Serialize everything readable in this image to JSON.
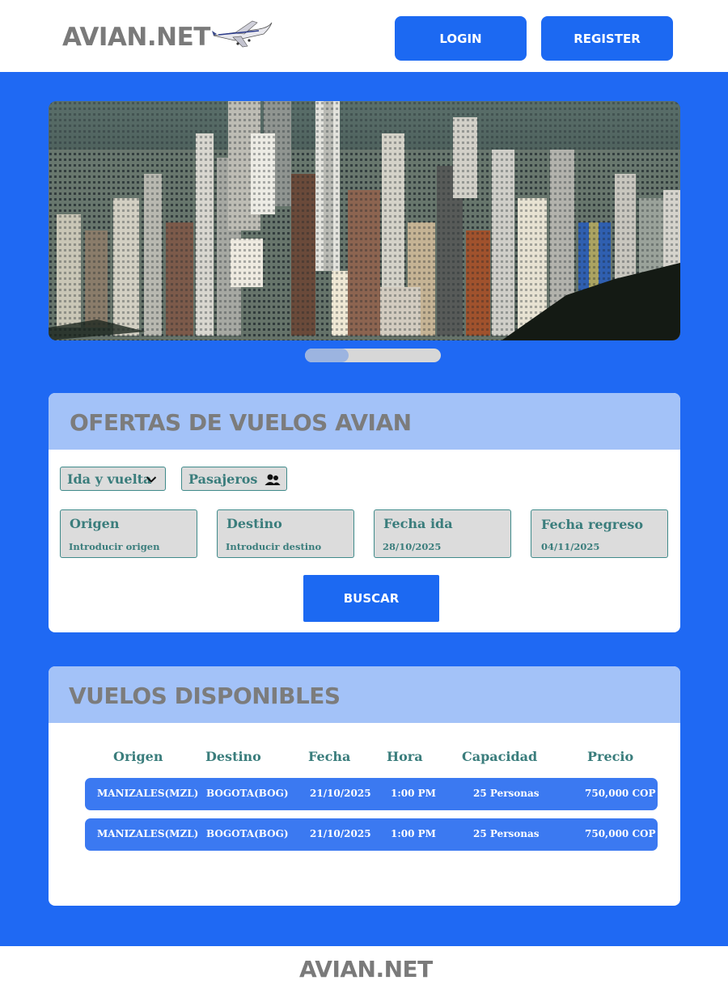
{
  "header": {
    "logo": "AVIAN.NET",
    "plane_icon": "airplane-icon",
    "login_label": "LOGIN",
    "register_label": "REGISTER"
  },
  "colors": {
    "primary": "#1f69f3",
    "button": "#1c69f2",
    "card_header": "#a3c2f8",
    "row": "#3b79f1",
    "label_teal": "#3a7d7c",
    "field_bg": "#dcdcdc"
  },
  "hero": {
    "image_icon": "city-skyline-image",
    "carousel_progress": 0.32
  },
  "offers": {
    "title": "OFERTAS DE VUELOS AVIAN",
    "trip_type": "Ida y vuelta",
    "passengers_label": "Pasajeros",
    "fields": [
      {
        "label": "Origen",
        "placeholder": "Introducir origen",
        "value": ""
      },
      {
        "label": "Destino",
        "placeholder": "Introducir destino",
        "value": ""
      },
      {
        "label": "Fecha ida",
        "placeholder": "",
        "value": "28/10/2025"
      },
      {
        "label": "Fecha regreso",
        "placeholder": "",
        "value": "04/11/2025"
      }
    ],
    "search_label": "BUSCAR"
  },
  "flights": {
    "title": "VUELOS DISPONIBLES",
    "columns": [
      "Origen",
      "Destino",
      "Fecha",
      "Hora",
      "Capacidad",
      "Precio"
    ],
    "rows": [
      [
        "MANIZALES(MZL)",
        "BOGOTA(BOG)",
        "21/10/2025",
        "1:00 PM",
        "25 Personas",
        "750,000 COP"
      ],
      [
        "MANIZALES(MZL)",
        "BOGOTA(BOG)",
        "21/10/2025",
        "1:00 PM",
        "25 Personas",
        "750,000 COP"
      ]
    ]
  },
  "footer": {
    "logo": "AVIAN.NET"
  }
}
